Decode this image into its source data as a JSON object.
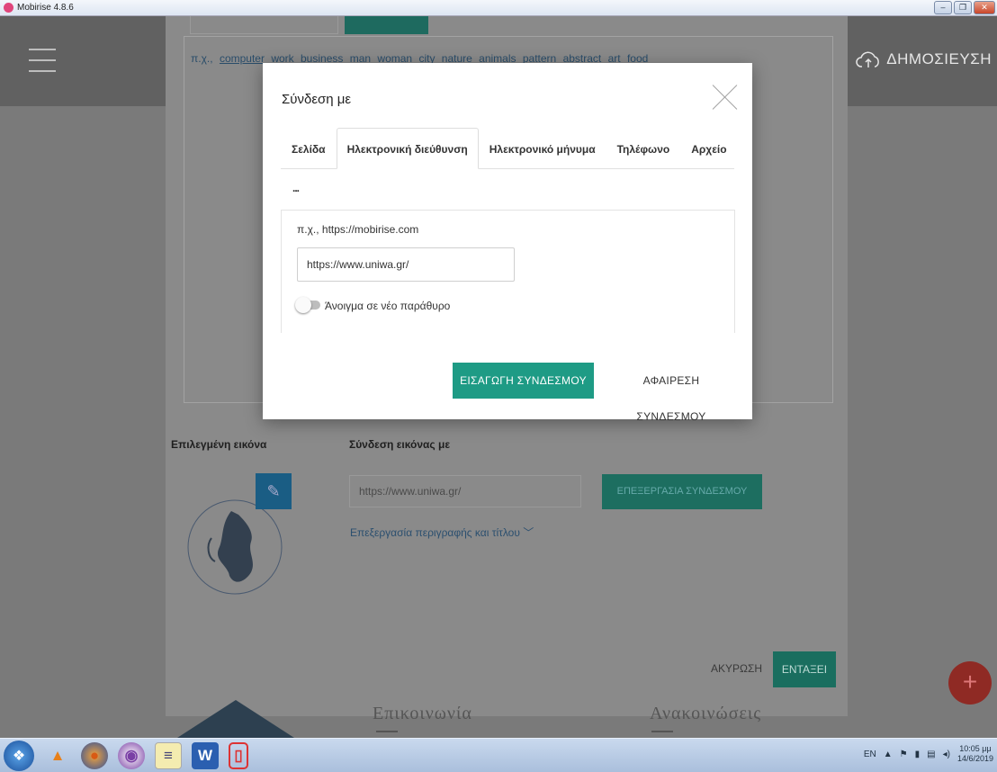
{
  "window": {
    "title": "Mobirise 4.8.6",
    "min": "–",
    "max": "❐",
    "close": "✕"
  },
  "topbar": {
    "publish_label": "ΔΗΜΟΣΙΕΥΣΗ"
  },
  "background": {
    "tags_prefix": "π.χ.,",
    "tags": [
      "computer",
      "work",
      "business",
      "man",
      "woman",
      "city",
      "nature",
      "animals",
      "pattern",
      "abstract",
      "art",
      "food"
    ],
    "selected_image_label": "Επιλεγμένη εικόνα",
    "image_link_label": "Σύνδεση εικόνας με",
    "image_link_value": "https://www.uniwa.gr/",
    "edit_link_button": "ΕΠΕΞΕΡΓΑΣΙΑ ΣΥΝΔΕΣΜΟΥ",
    "edit_desc_link": "Επεξεργασία περιγραφής και τίτλου",
    "cancel": "ΑΚΥΡΩΣΗ",
    "ok": "ΕΝΤΑΞΕΙ",
    "footer_text_1": "Επικοινωνία",
    "footer_text_2": "Ανακοινώσεις"
  },
  "modal": {
    "title": "Σύνδεση με",
    "tabs": [
      {
        "label": "Σελίδα"
      },
      {
        "label": "Ηλεκτρονική διεύθυνση"
      },
      {
        "label": "Ηλεκτρονικό μήνυμα"
      },
      {
        "label": "Τηλέφωνο"
      },
      {
        "label": "Αρχείο"
      }
    ],
    "active_tab": 1,
    "more": "...",
    "hint": "π.χ., https://mobirise.com",
    "url_value": "https://www.uniwa.gr/",
    "new_window_label": "Άνοιγμα σε νέο παράθυρο",
    "new_window_on": false,
    "insert_button": "ΕΙΣΑΓΩΓΗ ΣΥΝΔΕΣΜΟΥ",
    "remove_button": "ΑΦΑΙΡΕΣΗ ΣΥΝΔΕΣΜΟΥ"
  },
  "taskbar": {
    "lang": "EN",
    "time": "10:05 μμ",
    "date": "14/6/2019",
    "apps": [
      "start",
      "vlc",
      "firefox",
      "tor",
      "notepad",
      "word",
      "phone"
    ]
  },
  "colors": {
    "accent": "#1e9b85",
    "fab": "#8f2a24"
  }
}
